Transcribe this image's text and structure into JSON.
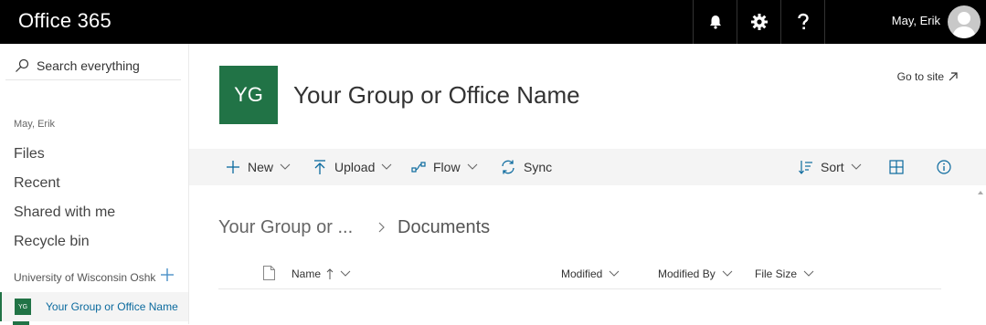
{
  "suitebar": {
    "app_title": "Office 365",
    "notifications_icon": "bell-icon",
    "settings_icon": "gear-icon",
    "help_icon": "question-icon",
    "user_name": "May, Erik"
  },
  "leftnav": {
    "search_placeholder": "Search everything",
    "owner_label": "May, Erik",
    "items": [
      {
        "label": "Files"
      },
      {
        "label": "Recent"
      },
      {
        "label": "Shared with me"
      },
      {
        "label": "Recycle bin"
      }
    ],
    "group_header": "University of Wisconsin Oshk",
    "selected_group": {
      "tile": "YG",
      "label": "Your Group or Office Name"
    }
  },
  "site": {
    "logo_text": "YG",
    "title": "Your Group or Office Name",
    "goto_label": "Go to site"
  },
  "commandbar": {
    "new_label": "New",
    "upload_label": "Upload",
    "flow_label": "Flow",
    "sync_label": "Sync",
    "sort_label": "Sort"
  },
  "breadcrumb": {
    "root": "Your Group or ...",
    "current": "Documents"
  },
  "columns": {
    "name": "Name",
    "modified": "Modified",
    "modified_by": "Modified By",
    "file_size": "File Size"
  },
  "colors": {
    "accent": "#217346",
    "suitebar": "#000000",
    "link": "#0b6a9e"
  }
}
